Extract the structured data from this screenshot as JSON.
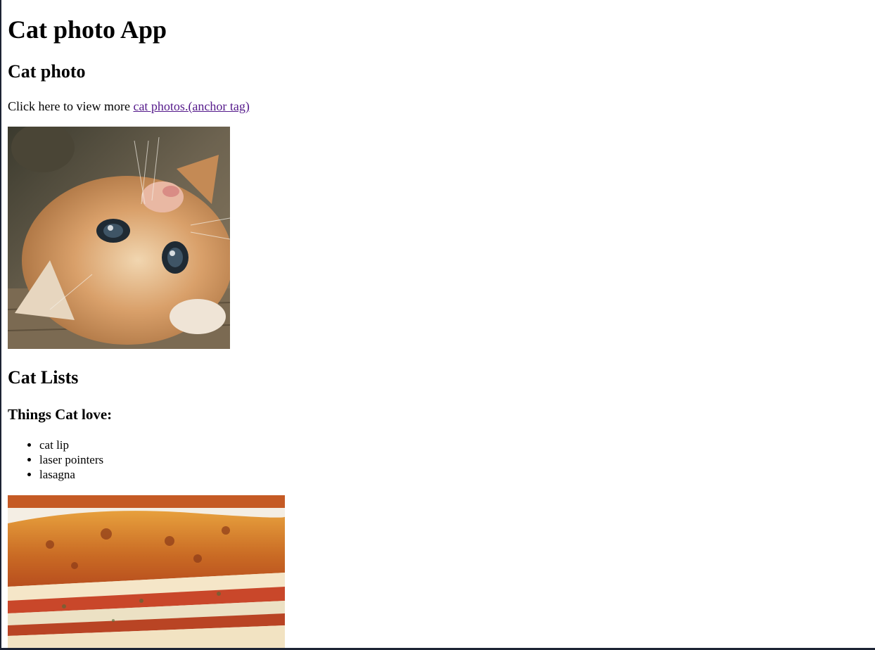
{
  "page": {
    "title": "Cat photo App",
    "photo_heading": "Cat photo",
    "intro_text": "Click here to view more ",
    "link_text": "cat photos.(anchor tag)",
    "lists_heading": "Cat Lists",
    "things_heading": "Things Cat love:",
    "things": [
      "cat lip",
      "laser pointers",
      "lasagna"
    ]
  },
  "colors": {
    "link": "#551a8b",
    "frame": "#1c2333"
  }
}
